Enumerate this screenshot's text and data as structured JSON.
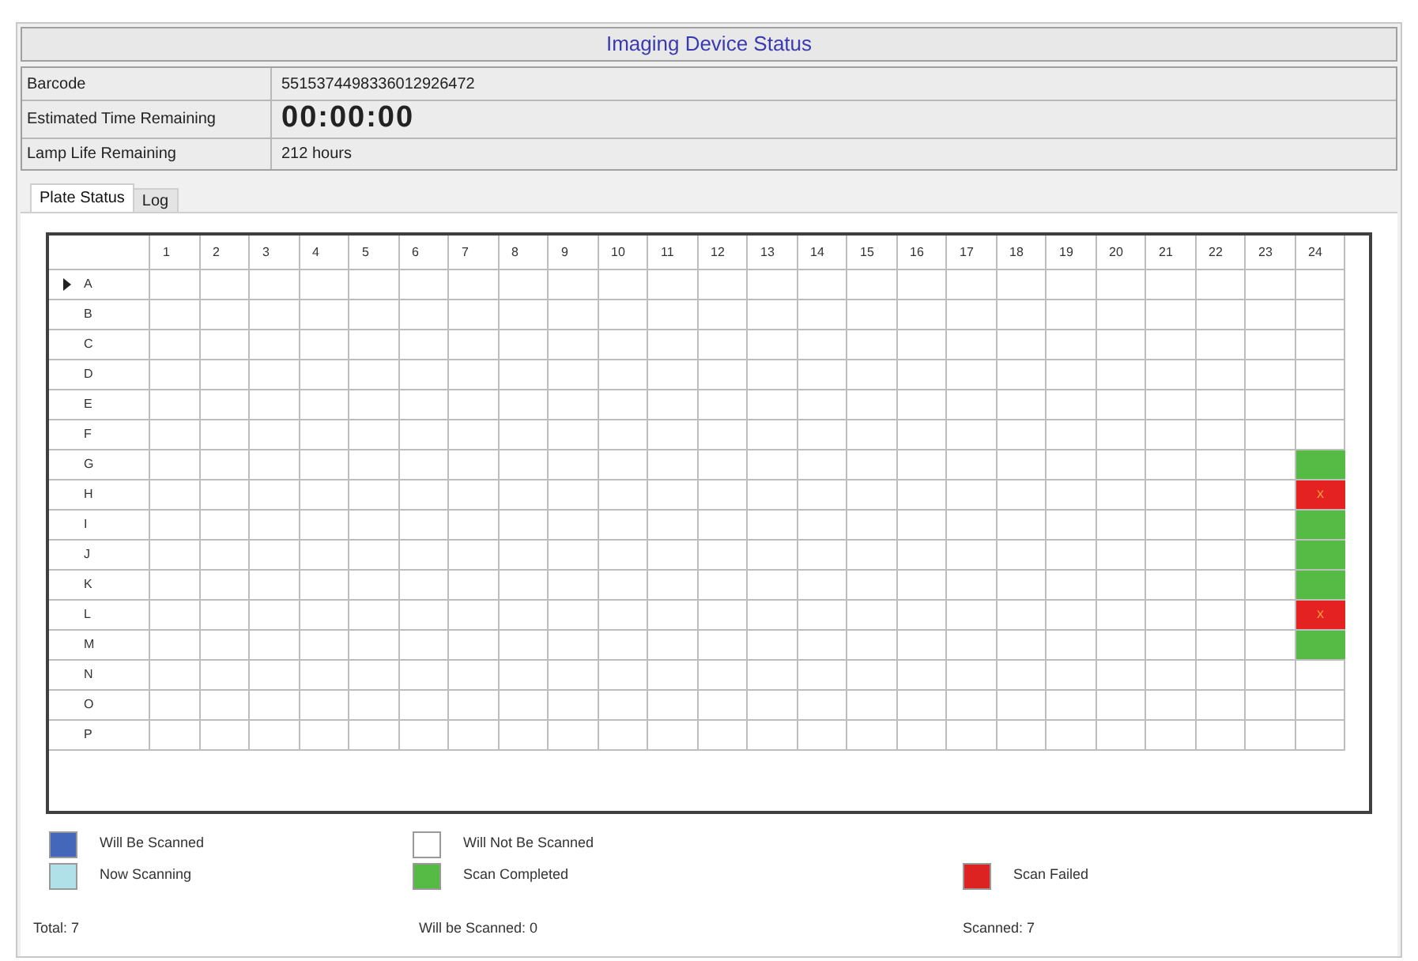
{
  "title": "Imaging Device Status",
  "info": [
    {
      "label": "Barcode",
      "value": "5515374498336012926472",
      "kind": "text"
    },
    {
      "label": "Estimated Time Remaining",
      "value": "00:00:00",
      "kind": "timer"
    },
    {
      "label": "Lamp Life Remaining",
      "value": "212 hours",
      "kind": "text"
    }
  ],
  "tabs": [
    {
      "label": "Plate Status",
      "selected": true
    },
    {
      "label": "Log",
      "selected": false
    }
  ],
  "plate": {
    "columns": [
      "1",
      "2",
      "3",
      "4",
      "5",
      "6",
      "7",
      "8",
      "9",
      "10",
      "11",
      "12",
      "13",
      "14",
      "15",
      "16",
      "17",
      "18",
      "19",
      "20",
      "21",
      "22",
      "23",
      "24"
    ],
    "rows": [
      {
        "label": "A",
        "current": true,
        "cells": [
          {
            "kind": "empty"
          },
          {
            "kind": "empty"
          },
          {
            "kind": "empty"
          },
          {
            "kind": "empty"
          },
          {
            "kind": "empty"
          },
          {
            "kind": "empty"
          },
          {
            "kind": "empty"
          },
          {
            "kind": "empty"
          },
          {
            "kind": "empty"
          },
          {
            "kind": "empty"
          },
          {
            "kind": "empty"
          },
          {
            "kind": "empty"
          },
          {
            "kind": "empty"
          },
          {
            "kind": "empty"
          },
          {
            "kind": "empty"
          },
          {
            "kind": "empty"
          },
          {
            "kind": "empty"
          },
          {
            "kind": "empty"
          },
          {
            "kind": "empty"
          },
          {
            "kind": "empty"
          },
          {
            "kind": "empty"
          },
          {
            "kind": "empty"
          },
          {
            "kind": "empty"
          },
          {
            "kind": "empty"
          }
        ]
      },
      {
        "label": "B",
        "current": false,
        "cells": [
          {
            "kind": "empty"
          },
          {
            "kind": "empty"
          },
          {
            "kind": "empty"
          },
          {
            "kind": "empty"
          },
          {
            "kind": "empty"
          },
          {
            "kind": "empty"
          },
          {
            "kind": "empty"
          },
          {
            "kind": "empty"
          },
          {
            "kind": "empty"
          },
          {
            "kind": "empty"
          },
          {
            "kind": "empty"
          },
          {
            "kind": "empty"
          },
          {
            "kind": "empty"
          },
          {
            "kind": "empty"
          },
          {
            "kind": "empty"
          },
          {
            "kind": "empty"
          },
          {
            "kind": "empty"
          },
          {
            "kind": "empty"
          },
          {
            "kind": "empty"
          },
          {
            "kind": "empty"
          },
          {
            "kind": "empty"
          },
          {
            "kind": "empty"
          },
          {
            "kind": "empty"
          },
          {
            "kind": "empty"
          }
        ]
      },
      {
        "label": "C",
        "current": false,
        "cells": [
          {
            "kind": "empty"
          },
          {
            "kind": "empty"
          },
          {
            "kind": "empty"
          },
          {
            "kind": "empty"
          },
          {
            "kind": "empty"
          },
          {
            "kind": "empty"
          },
          {
            "kind": "empty"
          },
          {
            "kind": "empty"
          },
          {
            "kind": "empty"
          },
          {
            "kind": "empty"
          },
          {
            "kind": "empty"
          },
          {
            "kind": "empty"
          },
          {
            "kind": "empty"
          },
          {
            "kind": "empty"
          },
          {
            "kind": "empty"
          },
          {
            "kind": "empty"
          },
          {
            "kind": "empty"
          },
          {
            "kind": "empty"
          },
          {
            "kind": "empty"
          },
          {
            "kind": "empty"
          },
          {
            "kind": "empty"
          },
          {
            "kind": "empty"
          },
          {
            "kind": "empty"
          },
          {
            "kind": "empty"
          }
        ]
      },
      {
        "label": "D",
        "current": false,
        "cells": [
          {
            "kind": "empty"
          },
          {
            "kind": "empty"
          },
          {
            "kind": "empty"
          },
          {
            "kind": "empty"
          },
          {
            "kind": "empty"
          },
          {
            "kind": "empty"
          },
          {
            "kind": "empty"
          },
          {
            "kind": "empty"
          },
          {
            "kind": "empty"
          },
          {
            "kind": "empty"
          },
          {
            "kind": "empty"
          },
          {
            "kind": "empty"
          },
          {
            "kind": "empty"
          },
          {
            "kind": "empty"
          },
          {
            "kind": "empty"
          },
          {
            "kind": "empty"
          },
          {
            "kind": "empty"
          },
          {
            "kind": "empty"
          },
          {
            "kind": "empty"
          },
          {
            "kind": "empty"
          },
          {
            "kind": "empty"
          },
          {
            "kind": "empty"
          },
          {
            "kind": "empty"
          },
          {
            "kind": "empty"
          }
        ]
      },
      {
        "label": "E",
        "current": false,
        "cells": [
          {
            "kind": "empty"
          },
          {
            "kind": "empty"
          },
          {
            "kind": "empty"
          },
          {
            "kind": "empty"
          },
          {
            "kind": "empty"
          },
          {
            "kind": "empty"
          },
          {
            "kind": "empty"
          },
          {
            "kind": "empty"
          },
          {
            "kind": "empty"
          },
          {
            "kind": "empty"
          },
          {
            "kind": "empty"
          },
          {
            "kind": "empty"
          },
          {
            "kind": "empty"
          },
          {
            "kind": "empty"
          },
          {
            "kind": "empty"
          },
          {
            "kind": "empty"
          },
          {
            "kind": "empty"
          },
          {
            "kind": "empty"
          },
          {
            "kind": "empty"
          },
          {
            "kind": "empty"
          },
          {
            "kind": "empty"
          },
          {
            "kind": "empty"
          },
          {
            "kind": "empty"
          },
          {
            "kind": "empty"
          }
        ]
      },
      {
        "label": "F",
        "current": false,
        "cells": [
          {
            "kind": "empty"
          },
          {
            "kind": "empty"
          },
          {
            "kind": "empty"
          },
          {
            "kind": "empty"
          },
          {
            "kind": "empty"
          },
          {
            "kind": "empty"
          },
          {
            "kind": "empty"
          },
          {
            "kind": "empty"
          },
          {
            "kind": "empty"
          },
          {
            "kind": "empty"
          },
          {
            "kind": "empty"
          },
          {
            "kind": "empty"
          },
          {
            "kind": "empty"
          },
          {
            "kind": "empty"
          },
          {
            "kind": "empty"
          },
          {
            "kind": "empty"
          },
          {
            "kind": "empty"
          },
          {
            "kind": "empty"
          },
          {
            "kind": "empty"
          },
          {
            "kind": "empty"
          },
          {
            "kind": "empty"
          },
          {
            "kind": "empty"
          },
          {
            "kind": "empty"
          },
          {
            "kind": "empty"
          }
        ]
      },
      {
        "label": "G",
        "current": false,
        "cells": [
          {
            "kind": "empty"
          },
          {
            "kind": "empty"
          },
          {
            "kind": "empty"
          },
          {
            "kind": "empty"
          },
          {
            "kind": "empty"
          },
          {
            "kind": "empty"
          },
          {
            "kind": "empty"
          },
          {
            "kind": "empty"
          },
          {
            "kind": "empty"
          },
          {
            "kind": "empty"
          },
          {
            "kind": "empty"
          },
          {
            "kind": "empty"
          },
          {
            "kind": "empty"
          },
          {
            "kind": "empty"
          },
          {
            "kind": "empty"
          },
          {
            "kind": "empty"
          },
          {
            "kind": "empty"
          },
          {
            "kind": "empty"
          },
          {
            "kind": "empty"
          },
          {
            "kind": "empty"
          },
          {
            "kind": "empty"
          },
          {
            "kind": "empty"
          },
          {
            "kind": "empty"
          },
          {
            "kind": "completed"
          }
        ]
      },
      {
        "label": "H",
        "current": false,
        "cells": [
          {
            "kind": "empty"
          },
          {
            "kind": "empty"
          },
          {
            "kind": "empty"
          },
          {
            "kind": "empty"
          },
          {
            "kind": "empty"
          },
          {
            "kind": "empty"
          },
          {
            "kind": "empty"
          },
          {
            "kind": "empty"
          },
          {
            "kind": "empty"
          },
          {
            "kind": "empty"
          },
          {
            "kind": "empty"
          },
          {
            "kind": "empty"
          },
          {
            "kind": "empty"
          },
          {
            "kind": "empty"
          },
          {
            "kind": "empty"
          },
          {
            "kind": "empty"
          },
          {
            "kind": "empty"
          },
          {
            "kind": "empty"
          },
          {
            "kind": "empty"
          },
          {
            "kind": "empty"
          },
          {
            "kind": "empty"
          },
          {
            "kind": "empty"
          },
          {
            "kind": "empty"
          },
          {
            "kind": "failed",
            "text": "x"
          }
        ]
      },
      {
        "label": "I",
        "current": false,
        "cells": [
          {
            "kind": "empty"
          },
          {
            "kind": "empty"
          },
          {
            "kind": "empty"
          },
          {
            "kind": "empty"
          },
          {
            "kind": "empty"
          },
          {
            "kind": "empty"
          },
          {
            "kind": "empty"
          },
          {
            "kind": "empty"
          },
          {
            "kind": "empty"
          },
          {
            "kind": "empty"
          },
          {
            "kind": "empty"
          },
          {
            "kind": "empty"
          },
          {
            "kind": "empty"
          },
          {
            "kind": "empty"
          },
          {
            "kind": "empty"
          },
          {
            "kind": "empty"
          },
          {
            "kind": "empty"
          },
          {
            "kind": "empty"
          },
          {
            "kind": "empty"
          },
          {
            "kind": "empty"
          },
          {
            "kind": "empty"
          },
          {
            "kind": "empty"
          },
          {
            "kind": "empty"
          },
          {
            "kind": "completed"
          }
        ]
      },
      {
        "label": "J",
        "current": false,
        "cells": [
          {
            "kind": "empty"
          },
          {
            "kind": "empty"
          },
          {
            "kind": "empty"
          },
          {
            "kind": "empty"
          },
          {
            "kind": "empty"
          },
          {
            "kind": "empty"
          },
          {
            "kind": "empty"
          },
          {
            "kind": "empty"
          },
          {
            "kind": "empty"
          },
          {
            "kind": "empty"
          },
          {
            "kind": "empty"
          },
          {
            "kind": "empty"
          },
          {
            "kind": "empty"
          },
          {
            "kind": "empty"
          },
          {
            "kind": "empty"
          },
          {
            "kind": "empty"
          },
          {
            "kind": "empty"
          },
          {
            "kind": "empty"
          },
          {
            "kind": "empty"
          },
          {
            "kind": "empty"
          },
          {
            "kind": "empty"
          },
          {
            "kind": "empty"
          },
          {
            "kind": "empty"
          },
          {
            "kind": "completed"
          }
        ]
      },
      {
        "label": "K",
        "current": false,
        "cells": [
          {
            "kind": "empty"
          },
          {
            "kind": "empty"
          },
          {
            "kind": "empty"
          },
          {
            "kind": "empty"
          },
          {
            "kind": "empty"
          },
          {
            "kind": "empty"
          },
          {
            "kind": "empty"
          },
          {
            "kind": "empty"
          },
          {
            "kind": "empty"
          },
          {
            "kind": "empty"
          },
          {
            "kind": "empty"
          },
          {
            "kind": "empty"
          },
          {
            "kind": "empty"
          },
          {
            "kind": "empty"
          },
          {
            "kind": "empty"
          },
          {
            "kind": "empty"
          },
          {
            "kind": "empty"
          },
          {
            "kind": "empty"
          },
          {
            "kind": "empty"
          },
          {
            "kind": "empty"
          },
          {
            "kind": "empty"
          },
          {
            "kind": "empty"
          },
          {
            "kind": "empty"
          },
          {
            "kind": "completed"
          }
        ]
      },
      {
        "label": "L",
        "current": false,
        "cells": [
          {
            "kind": "empty"
          },
          {
            "kind": "empty"
          },
          {
            "kind": "empty"
          },
          {
            "kind": "empty"
          },
          {
            "kind": "empty"
          },
          {
            "kind": "empty"
          },
          {
            "kind": "empty"
          },
          {
            "kind": "empty"
          },
          {
            "kind": "empty"
          },
          {
            "kind": "empty"
          },
          {
            "kind": "empty"
          },
          {
            "kind": "empty"
          },
          {
            "kind": "empty"
          },
          {
            "kind": "empty"
          },
          {
            "kind": "empty"
          },
          {
            "kind": "empty"
          },
          {
            "kind": "empty"
          },
          {
            "kind": "empty"
          },
          {
            "kind": "empty"
          },
          {
            "kind": "empty"
          },
          {
            "kind": "empty"
          },
          {
            "kind": "empty"
          },
          {
            "kind": "empty"
          },
          {
            "kind": "failed",
            "text": "x"
          }
        ]
      },
      {
        "label": "M",
        "current": false,
        "cells": [
          {
            "kind": "empty"
          },
          {
            "kind": "empty"
          },
          {
            "kind": "empty"
          },
          {
            "kind": "empty"
          },
          {
            "kind": "empty"
          },
          {
            "kind": "empty"
          },
          {
            "kind": "empty"
          },
          {
            "kind": "empty"
          },
          {
            "kind": "empty"
          },
          {
            "kind": "empty"
          },
          {
            "kind": "empty"
          },
          {
            "kind": "empty"
          },
          {
            "kind": "empty"
          },
          {
            "kind": "empty"
          },
          {
            "kind": "empty"
          },
          {
            "kind": "empty"
          },
          {
            "kind": "empty"
          },
          {
            "kind": "empty"
          },
          {
            "kind": "empty"
          },
          {
            "kind": "empty"
          },
          {
            "kind": "empty"
          },
          {
            "kind": "empty"
          },
          {
            "kind": "empty"
          },
          {
            "kind": "completed"
          }
        ]
      },
      {
        "label": "N",
        "current": false,
        "cells": [
          {
            "kind": "empty"
          },
          {
            "kind": "empty"
          },
          {
            "kind": "empty"
          },
          {
            "kind": "empty"
          },
          {
            "kind": "empty"
          },
          {
            "kind": "empty"
          },
          {
            "kind": "empty"
          },
          {
            "kind": "empty"
          },
          {
            "kind": "empty"
          },
          {
            "kind": "empty"
          },
          {
            "kind": "empty"
          },
          {
            "kind": "empty"
          },
          {
            "kind": "empty"
          },
          {
            "kind": "empty"
          },
          {
            "kind": "empty"
          },
          {
            "kind": "empty"
          },
          {
            "kind": "empty"
          },
          {
            "kind": "empty"
          },
          {
            "kind": "empty"
          },
          {
            "kind": "empty"
          },
          {
            "kind": "empty"
          },
          {
            "kind": "empty"
          },
          {
            "kind": "empty"
          },
          {
            "kind": "empty"
          }
        ]
      },
      {
        "label": "O",
        "current": false,
        "cells": [
          {
            "kind": "empty"
          },
          {
            "kind": "empty"
          },
          {
            "kind": "empty"
          },
          {
            "kind": "empty"
          },
          {
            "kind": "empty"
          },
          {
            "kind": "empty"
          },
          {
            "kind": "empty"
          },
          {
            "kind": "empty"
          },
          {
            "kind": "empty"
          },
          {
            "kind": "empty"
          },
          {
            "kind": "empty"
          },
          {
            "kind": "empty"
          },
          {
            "kind": "empty"
          },
          {
            "kind": "empty"
          },
          {
            "kind": "empty"
          },
          {
            "kind": "empty"
          },
          {
            "kind": "empty"
          },
          {
            "kind": "empty"
          },
          {
            "kind": "empty"
          },
          {
            "kind": "empty"
          },
          {
            "kind": "empty"
          },
          {
            "kind": "empty"
          },
          {
            "kind": "empty"
          },
          {
            "kind": "empty"
          }
        ]
      },
      {
        "label": "P",
        "current": false,
        "cells": [
          {
            "kind": "empty"
          },
          {
            "kind": "empty"
          },
          {
            "kind": "empty"
          },
          {
            "kind": "empty"
          },
          {
            "kind": "empty"
          },
          {
            "kind": "empty"
          },
          {
            "kind": "empty"
          },
          {
            "kind": "empty"
          },
          {
            "kind": "empty"
          },
          {
            "kind": "empty"
          },
          {
            "kind": "empty"
          },
          {
            "kind": "empty"
          },
          {
            "kind": "empty"
          },
          {
            "kind": "empty"
          },
          {
            "kind": "empty"
          },
          {
            "kind": "empty"
          },
          {
            "kind": "empty"
          },
          {
            "kind": "empty"
          },
          {
            "kind": "empty"
          },
          {
            "kind": "empty"
          },
          {
            "kind": "empty"
          },
          {
            "kind": "empty"
          },
          {
            "kind": "empty"
          },
          {
            "kind": "empty"
          }
        ]
      }
    ]
  },
  "legend": [
    [
      {
        "label": "Will Be Scanned",
        "color": "#4466bb"
      },
      {
        "label": "Now Scanning",
        "color": "#b0e0e8"
      }
    ],
    [
      {
        "label": "Will Not Be Scanned",
        "color": "#ffffff"
      },
      {
        "label": "Scan Completed",
        "color": "#55bb44"
      }
    ],
    [
      {
        "label": "Scan Failed",
        "color": "#dd2222"
      }
    ]
  ],
  "totals": [
    "Total: 7",
    "Will be Scanned: 0",
    "Scanned: 7"
  ]
}
